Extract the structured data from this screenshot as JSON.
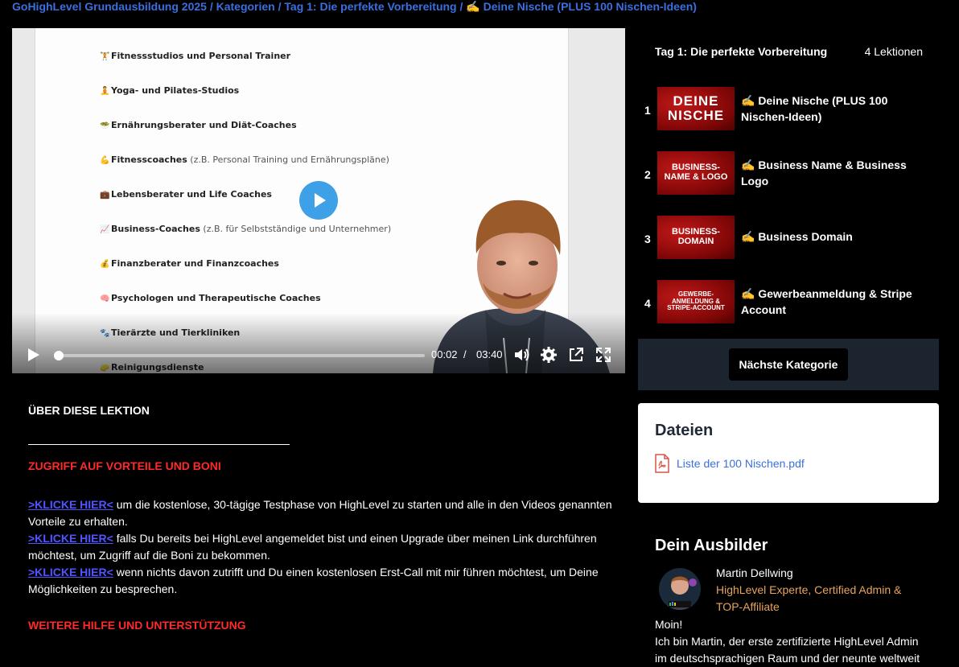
{
  "breadcrumb": {
    "course": "GoHighLevel Grundausbildung 2025",
    "sep1": " / ",
    "categories": "Kategorien",
    "sep2": " / ",
    "chapter": "Tag 1: Die perfekte Vorbereitung",
    "sep3": " / ",
    "lesson": "✍️ Deine Nische (PLUS 100 Nischen-Ideen)"
  },
  "video": {
    "slide_items": [
      {
        "emoji": "🏋️",
        "bold": "Fitnessstudios und Personal Trainer",
        "sub": ""
      },
      {
        "emoji": "🧘",
        "bold": "Yoga- und Pilates-Studios",
        "sub": ""
      },
      {
        "emoji": "🥗",
        "bold": "Ernährungsberater und Diät-Coaches",
        "sub": ""
      },
      {
        "emoji": "💪",
        "bold": "Fitnesscoaches",
        "sub": " (z.B. Personal Training und Ernährungspläne)"
      },
      {
        "emoji": "💼",
        "bold": "Lebensberater und Life Coaches",
        "sub": ""
      },
      {
        "emoji": "📈",
        "bold": "Business-Coaches",
        "sub": " (z.B. für Selbstständige und Unternehmer)"
      },
      {
        "emoji": "💰",
        "bold": "Finanzberater und Finanzcoaches",
        "sub": ""
      },
      {
        "emoji": "🧠",
        "bold": "Psychologen und Therapeutische Coaches",
        "sub": ""
      },
      {
        "emoji": "🐾",
        "bold": "Tierärzte und Tierkliniken",
        "sub": ""
      },
      {
        "emoji": "🧽",
        "bold": "Reinigungsdienste",
        "sub": ""
      }
    ],
    "current_time": "00:02",
    "time_sep": "/",
    "duration": "03:40",
    "progress_fraction": 0.009,
    "accent_color": "#3ea0e6",
    "icons": [
      "play-icon",
      "volume-icon",
      "settings-gear-icon",
      "popout-icon",
      "fullscreen-icon"
    ]
  },
  "chapter": {
    "title": "Tag 1: Die perfekte Vorbereitung",
    "count": "4 Lektionen",
    "lessons": [
      {
        "num": "1",
        "thumb": "DEINE\nNISCHE",
        "title": "✍️ Deine Nische (PLUS 100 Nischen-Ideen)"
      },
      {
        "num": "2",
        "thumb": "BUSINESS-\nNAME & LOGO",
        "title": "✍️ Business Name & Business Logo"
      },
      {
        "num": "3",
        "thumb": "BUSINESS-\nDOMAIN",
        "title": "✍️ Business Domain"
      },
      {
        "num": "4",
        "thumb": "GEWERBE-\nANMELDUNG &\nSTRIPE-ACCOUNT",
        "title": "✍️ Gewerbeanmeldung & Stripe Account"
      }
    ],
    "next_button": "Nächste Kategorie"
  },
  "files": {
    "heading": "Dateien",
    "file_name": "Liste der 100 Nischen.pdf"
  },
  "instructor": {
    "heading": "Dein Ausbilder",
    "name": "Martin Dellwing",
    "role": "HighLevel Experte, Certified Admin & TOP-Affiliate",
    "bio_line1": "Moin!",
    "bio_line2": "Ich bin Martin, der erste zertifizierte HighLevel Admin im deutschsprachigen Raum und der neunte weltweit"
  },
  "description": {
    "heading": "ÜBER DIESE LEKTION",
    "section1": "ZUGRIFF AUF VORTEILE UND BONI",
    "link_label": ">KLICKE HIER<",
    "p1": " um die kostenlose, 30-tägige Testphase von HighLevel zu starten und alle in den Videos genannten Vorteile zu erhalten.",
    "p2": " falls Du bereits bei HighLevel angemeldet bist und einen Upgrade über meinen Link durchführen möchtest, um Zugriff auf die Boni zu bekommen.",
    "p3": " wenn nichts davon zutrifft und Du einen kostenlosen Erst-Call mit mir führen möchtest, um Deine Möglichkeiten zu besprechen.",
    "section2": "WEITERE HILFE UND UNTERSTÜTZUNG"
  }
}
